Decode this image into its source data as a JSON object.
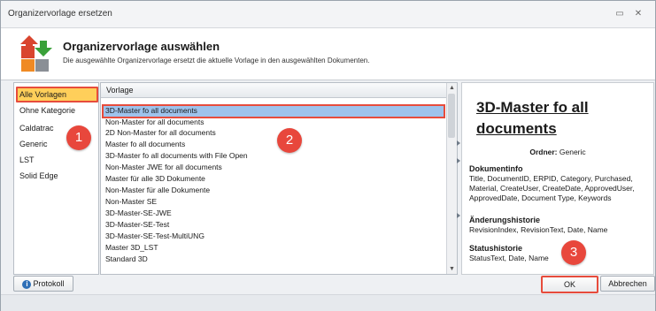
{
  "window": {
    "title": "Organizervorlage ersetzen",
    "minimize_glyph": "▭",
    "close_glyph": "✕"
  },
  "header": {
    "title": "Organizervorlage auswählen",
    "subtitle": "Die ausgewählte Organizervorlage ersetzt die aktuelle Vorlage in den ausgewählten Dokumenten."
  },
  "categories": {
    "items": [
      {
        "label": "Alle Vorlagen",
        "selected": true
      },
      {
        "label": "Ohne Kategorie",
        "selected": false
      },
      {
        "label": "Caldatrac",
        "selected": false
      },
      {
        "label": "Generic",
        "selected": false
      },
      {
        "label": "LST",
        "selected": false
      },
      {
        "label": "Solid Edge",
        "selected": false
      }
    ]
  },
  "templates": {
    "column_header": "Vorlage",
    "rows": [
      "3D-Master fo all documents",
      "Non-Master for all documents",
      "2D Non-Master for all documents",
      "Master fo all documents",
      "3D-Master fo all documents with File Open",
      "Non-Master JWE for all documents",
      "Master für alle 3D Dokumente",
      "Non-Master für alle Dokumente",
      "Non-Master SE",
      "3D-Master-SE-JWE",
      "3D-Master-SE-Test",
      "3D-Master-SE-Test-MultiUNG",
      "Master 3D_LST",
      "Standard 3D"
    ],
    "selected_index": 0
  },
  "preview": {
    "title": "3D-Master fo all documents",
    "folder_label": "Ordner:",
    "folder_value": "Generic",
    "sections": [
      {
        "heading": "Dokumentinfo",
        "text": "Title, DocumentID, ERPID, Category, Purchased, Material, CreateUser, CreateDate, ApprovedUser, ApprovedDate, Document Type, Keywords"
      },
      {
        "heading": "Änderungshistorie",
        "text": "RevisionIndex, RevisionText, Date, Name"
      },
      {
        "heading": "Statushistorie",
        "text": "StatusText, Date, Name"
      }
    ]
  },
  "badges": [
    "1",
    "2",
    "3"
  ],
  "footer": {
    "protokoll_label": "Protokoll",
    "ok_label": "OK",
    "cancel_label": "Abbrechen"
  },
  "colors": {
    "selection_highlight": "#9ec3ec",
    "category_selection": "#ffcf5a",
    "annotation_red": "#e74c3c",
    "logo_red": "#d9452f",
    "logo_green": "#3aa13a",
    "logo_orange": "#f08a24",
    "logo_gray": "#8a8f96"
  }
}
